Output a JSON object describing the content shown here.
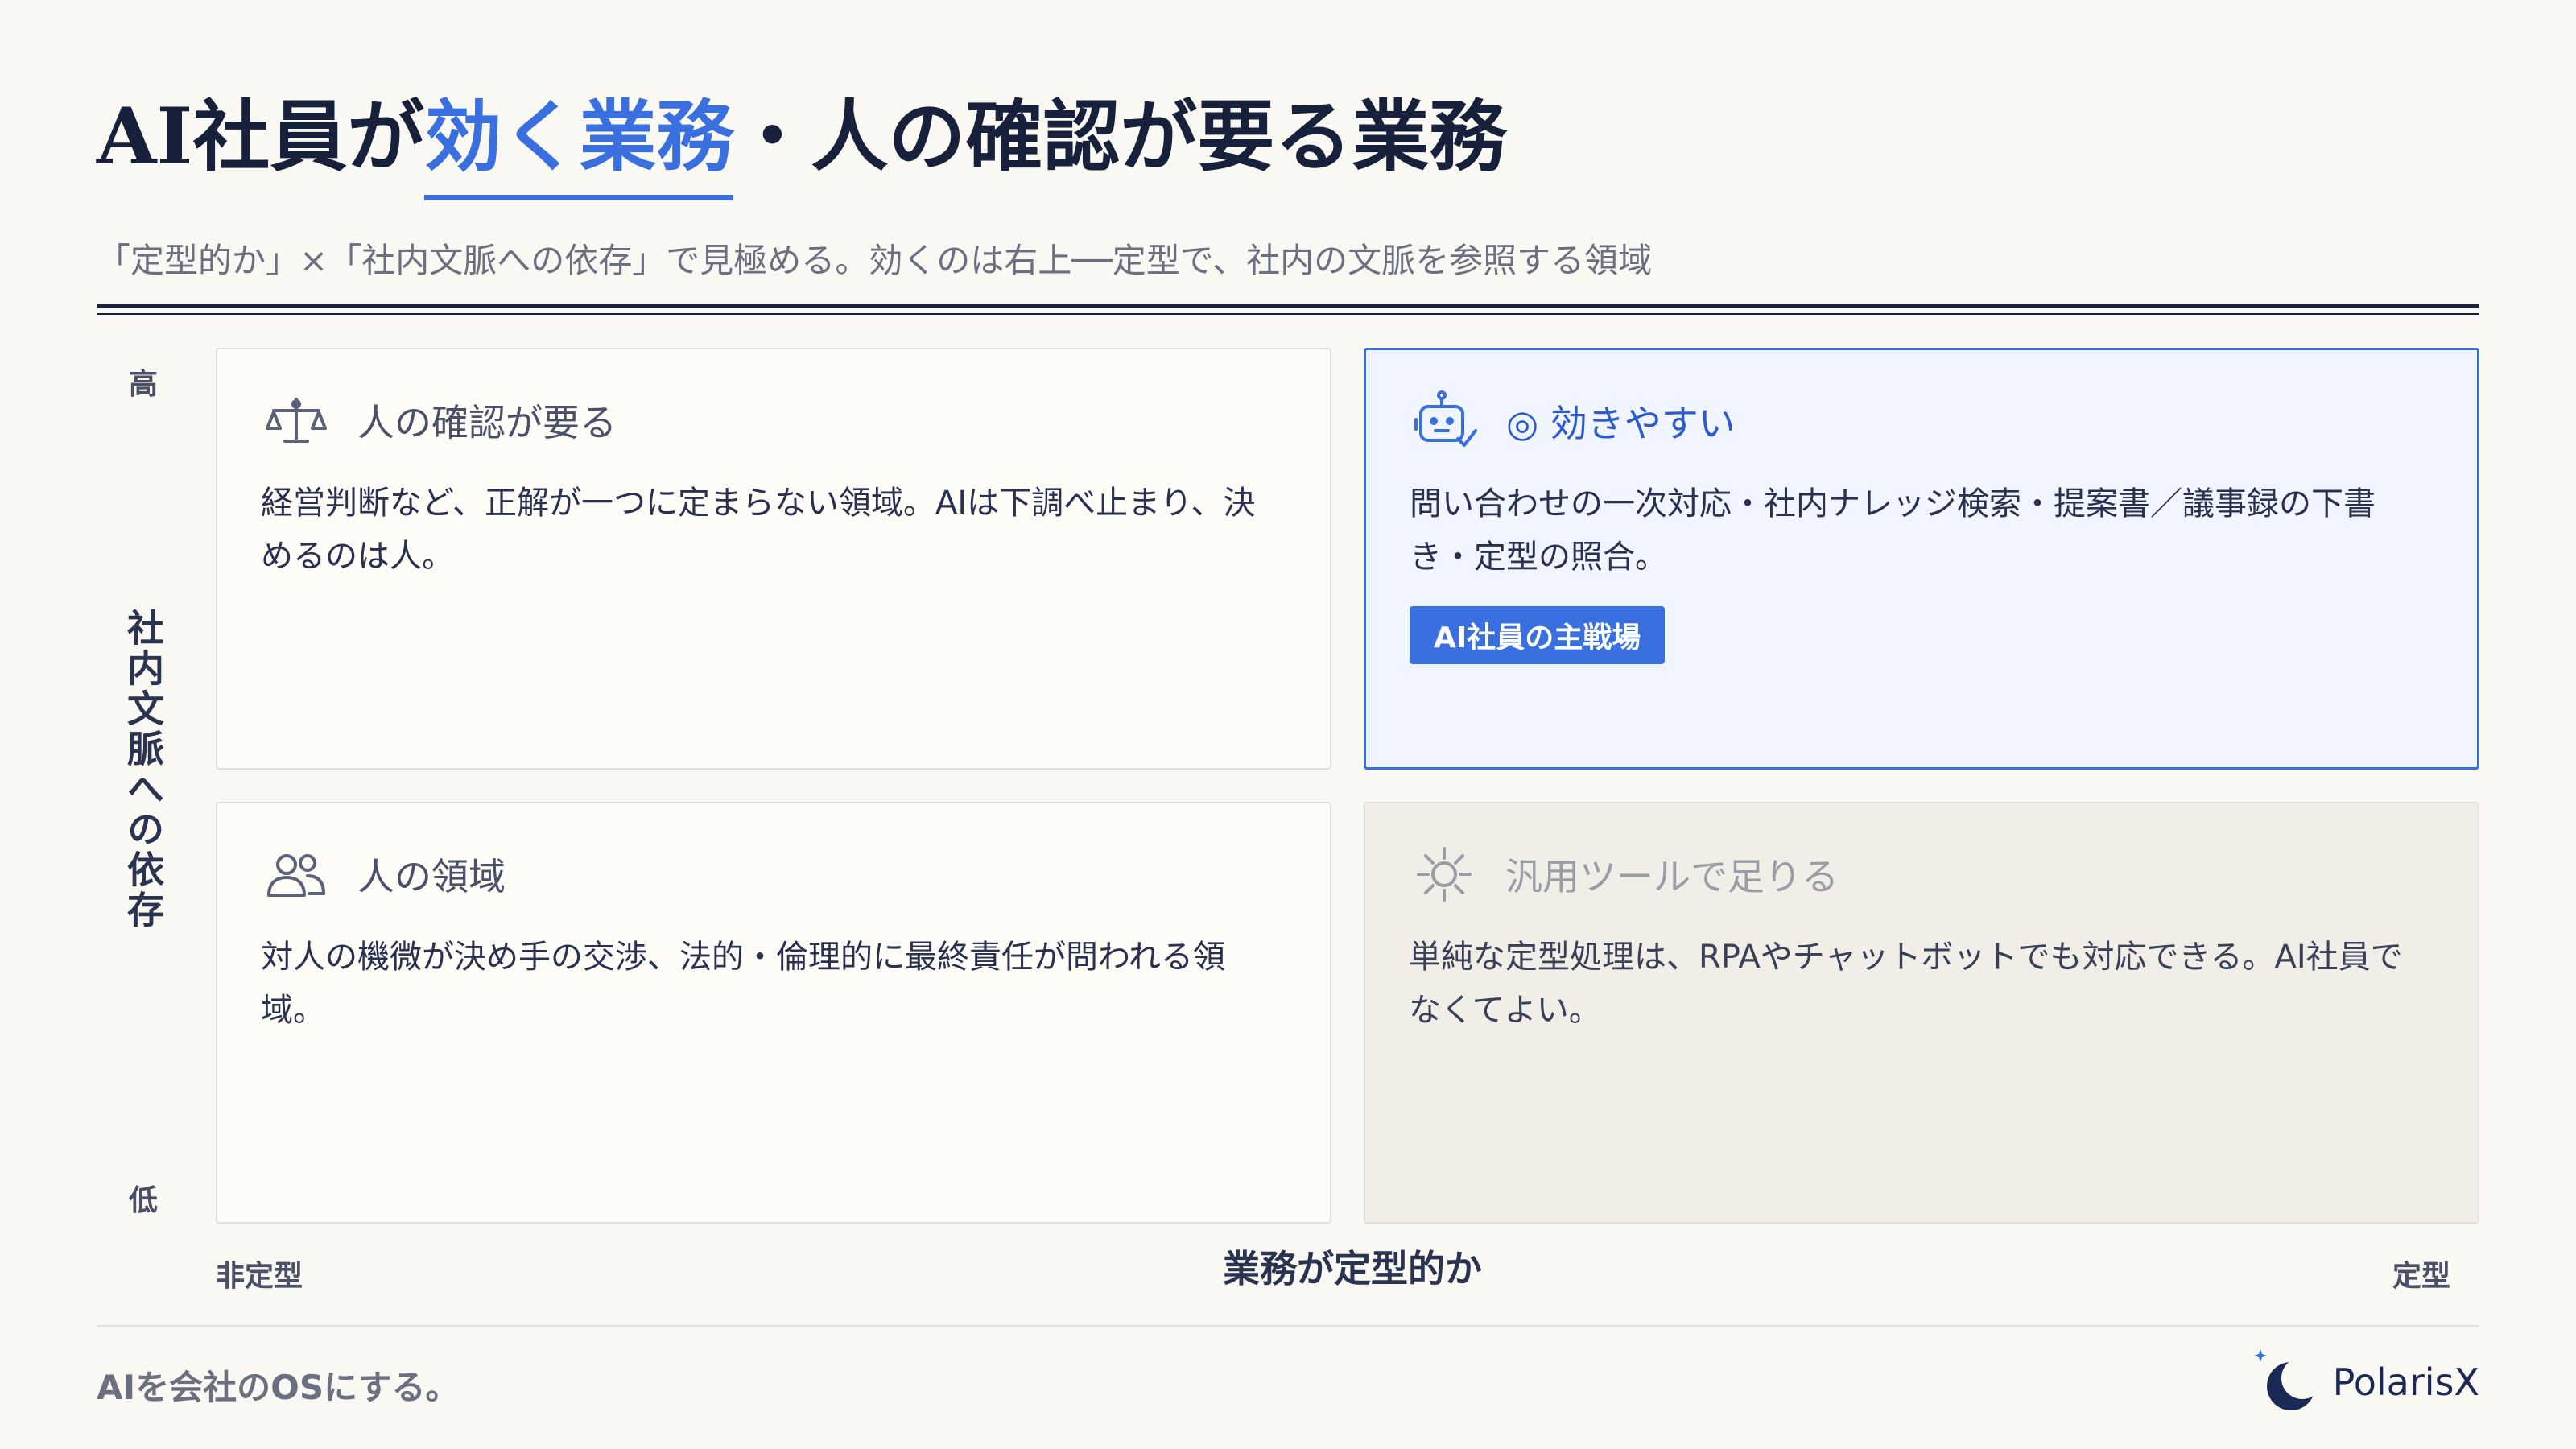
{
  "title": {
    "prefix": "AI社員が",
    "highlight": "効く業務",
    "suffix": "・人の確認が要る業務"
  },
  "subtitle": "「定型的か」×「社内文脈への依存」で見極める。効くのは右上──定型で、社内の文脈を参照する領域",
  "y_axis": {
    "title": "社内文脈への依存",
    "high": "高",
    "low": "低"
  },
  "x_axis": {
    "title": "業務が定型的か",
    "left": "非定型",
    "right": "定型"
  },
  "quadrants": {
    "top_left": {
      "icon": "scale-icon",
      "title": "人の確認が要る",
      "desc": "経営判断など、正解が一つに定まらない領域。AIは下調べ止まり、決めるのは人。"
    },
    "top_right": {
      "icon": "robot-check-icon",
      "title": "◎ 効きやすい",
      "desc": "問い合わせの一次対応・社内ナレッジ検索・提案書／議事録の下書き・定型の照合。",
      "badge": "AI社員の主戦場"
    },
    "bottom_left": {
      "icon": "people-icon",
      "title": "人の領域",
      "desc": "対人の機微が決め手の交渉、法的・倫理的に最終責任が問われる領域。"
    },
    "bottom_right": {
      "icon": "gear-icon",
      "title": "汎用ツールで足りる",
      "desc": "単純な定型処理は、RPAやチャットボットでも対応できる。AI社員でなくてよい。"
    }
  },
  "footer": {
    "tagline": "AIを会社のOSにする。",
    "brand": "PolarisX"
  },
  "colors": {
    "accent": "#3a6fe0",
    "navy": "#17213b",
    "background": "#faf8f3"
  }
}
